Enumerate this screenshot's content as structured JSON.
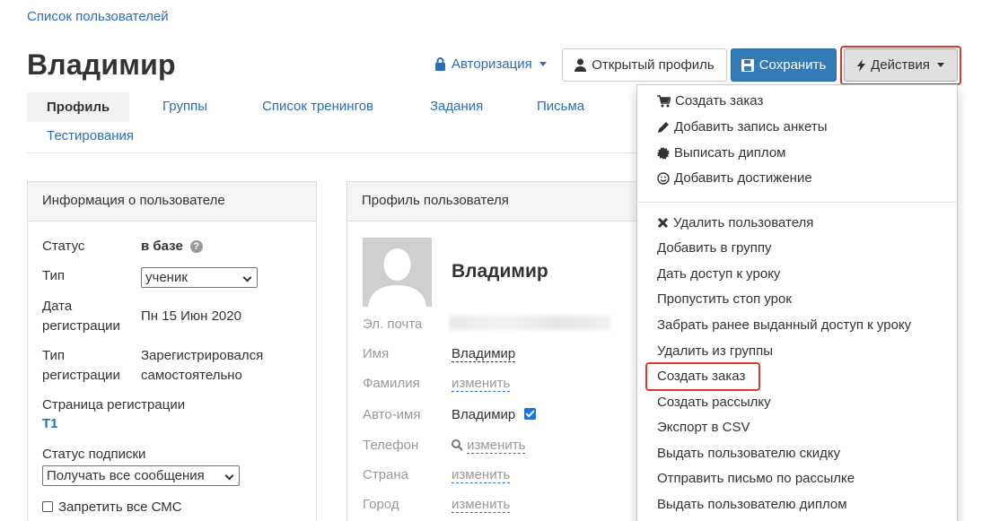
{
  "breadcrumb": "Список пользователей",
  "title": "Владимир",
  "header": {
    "auth_label": "Авторизация",
    "open_profile_label": "Открытый профиль",
    "save_label": "Сохранить",
    "actions_label": "Действия"
  },
  "tabs": [
    "Профиль",
    "Группы",
    "Список тренингов",
    "Задания",
    "Письма",
    "Тестирования"
  ],
  "user_info": {
    "heading": "Информация о пользователе",
    "status_label": "Статус",
    "status_value": "в базе",
    "type_label": "Тип",
    "type_value": "ученик",
    "reg_date_label_1": "Дата",
    "reg_date_label_2": "регистрации",
    "reg_date_value": "Пн 15 Июн 2020",
    "reg_type_label_1": "Тип",
    "reg_type_label_2": "регистрации",
    "reg_type_value_1": "Зарегистрировался",
    "reg_type_value_2": "самостоятельно",
    "reg_page_label": "Страница регистрации",
    "reg_page_value": "T1",
    "subscription_label": "Статус подписки",
    "subscription_value": "Получать все сообщения",
    "block_sms_label": "Запретить все СМС"
  },
  "profile": {
    "heading": "Профиль пользователя",
    "name": "Владимир",
    "email_label": "Эл. почта",
    "first_name_label": "Имя",
    "first_name_value": "Владимир",
    "last_name_label": "Фамилия",
    "last_name_value": "изменить",
    "auto_name_label": "Авто-имя",
    "auto_name_value": "Владимир",
    "phone_label": "Телефон",
    "phone_value": "изменить",
    "country_label": "Страна",
    "country_value": "изменить",
    "city_label": "Город",
    "city_value": "изменить"
  },
  "dropdown": {
    "group1": [
      {
        "icon": "cart-icon",
        "label": "Создать заказ"
      },
      {
        "icon": "pencil-icon",
        "label": "Добавить запись анкеты"
      },
      {
        "icon": "certificate-icon",
        "label": "Выписать диплом"
      },
      {
        "icon": "smile-icon",
        "label": "Добавить достижение"
      }
    ],
    "group2": [
      {
        "icon": "remove-icon",
        "label": "Удалить пользователя"
      },
      {
        "icon": "",
        "label": "Добавить в группу"
      },
      {
        "icon": "",
        "label": "Дать доступ к уроку"
      },
      {
        "icon": "",
        "label": "Пропустить стоп урок"
      },
      {
        "icon": "",
        "label": "Забрать ранее выданный доступ к уроку"
      },
      {
        "icon": "",
        "label": "Удалить из группы"
      },
      {
        "icon": "",
        "label": "Создать заказ"
      },
      {
        "icon": "",
        "label": "Создать рассылку"
      },
      {
        "icon": "",
        "label": "Экспорт в CSV"
      },
      {
        "icon": "",
        "label": "Выдать пользователю скидку"
      },
      {
        "icon": "",
        "label": "Отправить письмо по рассылке"
      },
      {
        "icon": "",
        "label": "Выдать пользователю диплом"
      }
    ]
  },
  "colors": {
    "link": "#2a6ebb",
    "primary": "#337ab7",
    "highlight": "#d9372f"
  }
}
